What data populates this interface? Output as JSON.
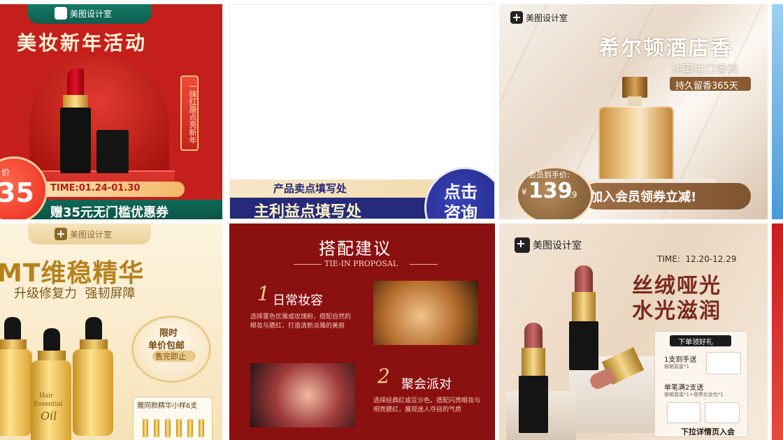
{
  "brand": "美图设计室",
  "tile1": {
    "title": "美妆新年活动",
    "ribbon": "一抹红唇点亮新年",
    "price_label": "价",
    "price": "35",
    "time": "TIME:01.24-01.30",
    "coupon": "赠35元无门槛优惠券"
  },
  "tile2": {
    "selling_point": "产品卖点填写处",
    "main_benefit": "主利益点填写处",
    "cta_line1": "点击",
    "cta_line2": "咨询"
  },
  "tile3": {
    "title": "希尔顿酒店香",
    "subtitle": "法国进口香料",
    "tag": "持久留香365天",
    "member_label": "会员到手价:",
    "currency": "¥",
    "price_int": "139",
    "price_dec": ".9",
    "cta": "加入会员领券立减!"
  },
  "tile5": {
    "title": "MT维稳精华",
    "subtitle": "升级修复力  强韧屏障",
    "badge_line1": "限时",
    "badge_line2": "单价包邮",
    "badge_line3": "售完即止",
    "bottle_text_1": "Hair",
    "bottle_text_2": "Essential",
    "bottle_text_3": "Oil",
    "gift_label": "赠同款精华小样6支"
  },
  "tile6": {
    "title": "搭配建议",
    "subtitle_en": "TIE-IN PROPOSAL",
    "item1_num": "1",
    "item1_title": "日常妆容",
    "item1_desc": "选择雾色优雅或玫瑰粉，搭配自然的眼妆与腮红，打造清新淡雅的美丽",
    "item2_num": "2",
    "item2_title": "聚会派对",
    "item2_desc": "选择经典红或豆沙色，搭配闪亮眼妆与明亮腮红，展现迷人夺目的气质"
  },
  "tile7": {
    "time": "TIME:  12.20-12.29",
    "title_line1": "丝绒哑光",
    "title_line2": "水光滋润",
    "panel_header": "下单领好礼",
    "gift1_title": "1支到手送",
    "gift1_desc": "银箱唇蜜*1",
    "gift2_title": "单笔满2支送",
    "gift2_desc": "银箱唇蜜*1+便携化妆包*1",
    "footer": "下拉详情页入会"
  }
}
